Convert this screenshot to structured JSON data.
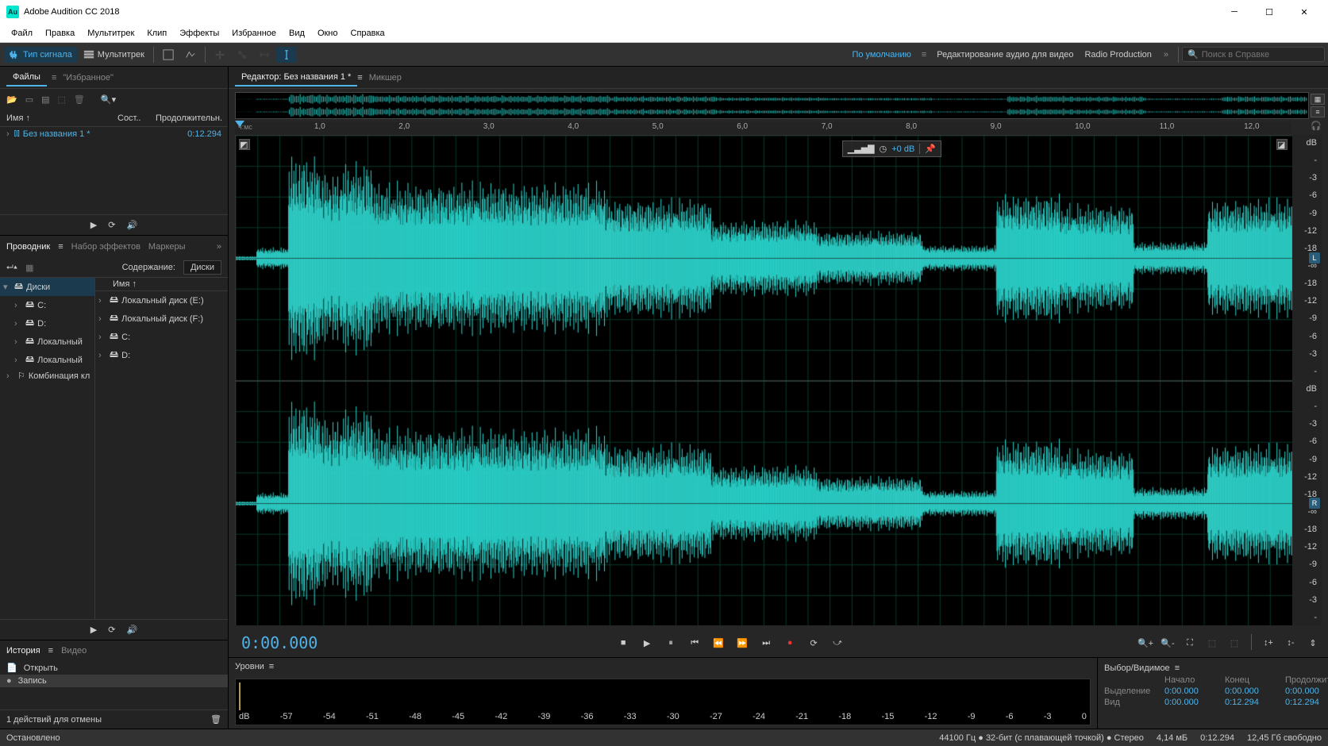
{
  "app": {
    "title": "Adobe Audition CC 2018",
    "logo": "Au"
  },
  "menu": [
    "Файл",
    "Правка",
    "Мультитрек",
    "Клип",
    "Эффекты",
    "Избранное",
    "Вид",
    "Окно",
    "Справка"
  ],
  "toolbar": {
    "waveform": "Тип сигнала",
    "multitrack": "Мультитрек",
    "workspace_default": "По умолчанию",
    "workspace_video": "Редактирование аудио для видео",
    "workspace_radio": "Radio Production",
    "search_placeholder": "Поиск в Справке"
  },
  "files": {
    "tab_files": "Файлы",
    "tab_fav": "\"Избранное\"",
    "col_name": "Имя ↑",
    "col_state": "Сост..",
    "col_duration": "Продолжительн.",
    "item_name": "Без названия 1 *",
    "item_duration": "0:12.294"
  },
  "explorer": {
    "tab_explorer": "Проводник",
    "tab_effects": "Набор эффектов",
    "tab_markers": "Маркеры",
    "label_content": "Содержание:",
    "label_disks": "Диски",
    "col_name": "Имя ↑",
    "tree_left": [
      "Диски",
      "C:",
      "D:",
      "Локальный",
      "Локальный",
      "Комбинация кл"
    ],
    "tree_right": [
      "Локальный диск (E:)",
      "Локальный диск (F:)",
      "C:",
      "D:"
    ]
  },
  "history": {
    "tab_history": "История",
    "tab_video": "Видео",
    "item_open": "Открыть",
    "item_record": "Запись",
    "undo_text": "1 действий для отмены"
  },
  "editor": {
    "tab_editor": "Редактор: Без названия 1 *",
    "tab_mixer": "Микшер",
    "hms_label": "ч:мс",
    "timeline_ticks": [
      "1,0",
      "2,0",
      "3,0",
      "4,0",
      "5,0",
      "6,0",
      "7,0",
      "8,0",
      "9,0",
      "10,0",
      "11,0",
      "12,0"
    ],
    "hud_db": "+0 dB",
    "db_unit": "dB",
    "db_ticks": [
      "dB",
      "-",
      "-3",
      "-6",
      "-9",
      "-12",
      "-18",
      "-∞",
      "-18",
      "-12",
      "-9",
      "-6",
      "-3",
      "-"
    ],
    "ch_l": "L",
    "ch_r": "R",
    "timecode": "0:00.000"
  },
  "levels": {
    "title": "Уровни",
    "db_unit": "dB",
    "scale": [
      "-57",
      "-54",
      "-51",
      "-48",
      "-45",
      "-42",
      "-39",
      "-36",
      "-33",
      "-30",
      "-27",
      "-24",
      "-21",
      "-18",
      "-15",
      "-12",
      "-9",
      "-6",
      "-3",
      "0"
    ]
  },
  "selection": {
    "title": "Выбор/Видимое",
    "col_start": "Начало",
    "col_end": "Конец",
    "col_dur": "Продолжительность",
    "row_sel": "Выделение",
    "row_view": "Вид",
    "sel_start": "0:00.000",
    "sel_end": "0:00.000",
    "sel_dur": "0:00.000",
    "view_start": "0:00.000",
    "view_end": "0:12.294",
    "view_dur": "0:12.294"
  },
  "status": {
    "stopped": "Остановлено",
    "format": "44100 Гц ● 32-бит (с плавающей точкой) ● Стерео",
    "size": "4,14 мБ",
    "dur": "0:12.294",
    "free": "12,45 Гб свободно"
  }
}
